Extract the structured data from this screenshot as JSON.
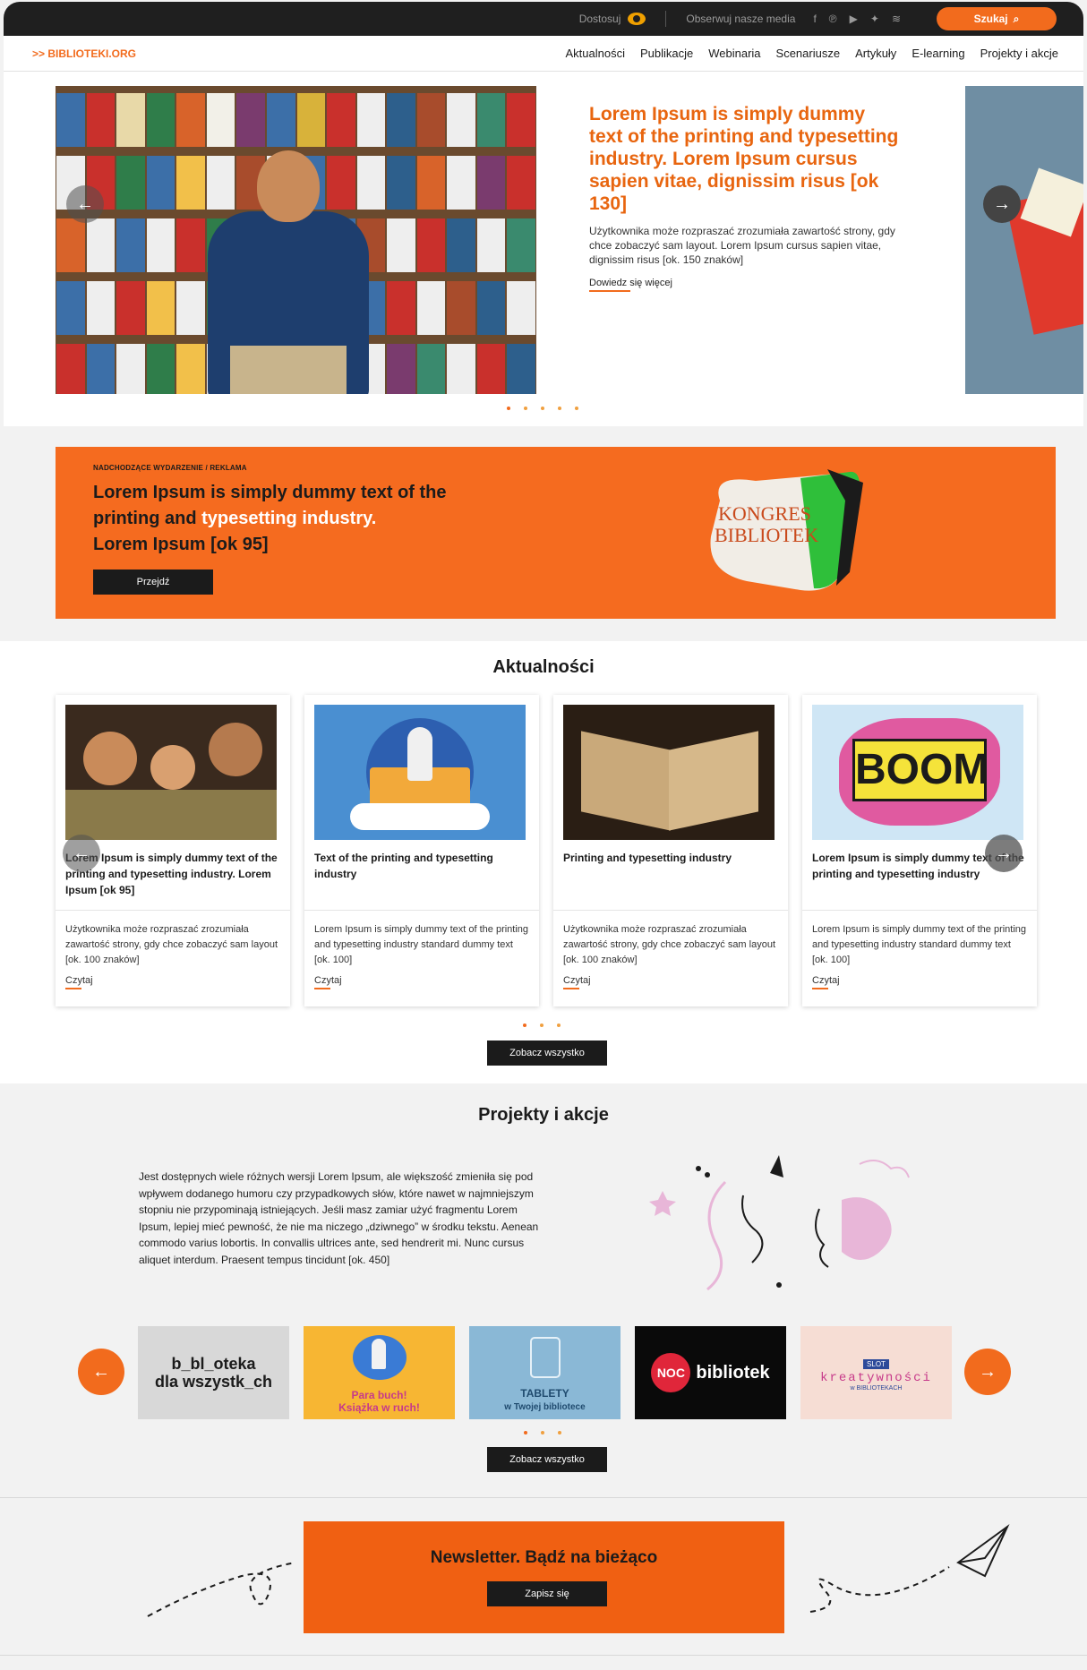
{
  "topbar": {
    "customize_label": "Dostosuj",
    "follow_label": "Obserwuj nasze media",
    "social_icons": [
      "facebook-icon",
      "pinterest-icon",
      "youtube-icon",
      "twitter-icon",
      "rss-icon"
    ],
    "search_label": "Szukaj"
  },
  "nav": {
    "logo": ">> BIBLIOTEKI.ORG",
    "items": [
      "Aktualności",
      "Publikacje",
      "Webinaria",
      "Scenariusze",
      "Artykuły",
      "E-learning",
      "Projekty i akcje"
    ]
  },
  "hero": {
    "title": "Lorem Ipsum is simply dummy text of the printing and typesetting industry. Lorem Ipsum cursus sapien vitae, dignissim risus [ok 130]",
    "description": "Użytkownika może rozpraszać zrozumiała zawartość strony, gdy chce zobaczyć sam layout. Lorem Ipsum cursus sapien vitae, dignissim risus [ok. 150 znaków]",
    "link": "Dowiedz się więcej",
    "slide_count": 5,
    "active_slide": 1
  },
  "banner": {
    "kicker": "NADCHODZĄCE WYDARZENIE / REKLAMA",
    "title_part1": "Lorem Ipsum is simply dummy text of the printing and ",
    "title_highlight": "typesetting industry.",
    "title_part2": "Lorem Ipsum [ok 95]",
    "button": "Przejdź",
    "logo_line1": "KONGRES",
    "logo_line2": "BIBLIOTEK"
  },
  "news": {
    "title": "Aktualności",
    "cards": [
      {
        "title": "Lorem Ipsum is simply dummy text of the printing and typesetting industry. Lorem Ipsum [ok 95]",
        "desc": "Użytkownika może rozpraszać zrozumiała zawartość strony, gdy chce zobaczyć sam layout [ok. 100 znaków]",
        "link": "Czytaj"
      },
      {
        "title": "Text of the printing and typesetting industry",
        "desc": "Lorem Ipsum is simply dummy text of the printing and typesetting industry standard dummy text [ok. 100]",
        "link": "Czytaj"
      },
      {
        "title": "Printing and typesetting industry",
        "desc": "Użytkownika może rozpraszać zrozumiała zawartość strony, gdy chce zobaczyć sam layout [ok. 100 znaków]",
        "link": "Czytaj"
      },
      {
        "title": "Lorem Ipsum is simply dummy text of the printing and typesetting industry",
        "desc": "Lorem Ipsum is simply dummy text of the printing and typesetting industry standard dummy text [ok. 100]",
        "link": "Czytaj"
      }
    ],
    "see_all": "Zobacz wszystko"
  },
  "projects": {
    "title": "Projekty i akcje",
    "text": "Jest dostępnych wiele różnych wersji Lorem Ipsum, ale większość zmieniła się pod wpływem dodanego humoru czy przypadkowych słów, które nawet w najmniejszym stopniu nie przypominają istniejących. Jeśli masz zamiar użyć fragmentu Lorem Ipsum, lepiej mieć pewność, że nie ma niczego „dziwnego” w środku tekstu. Aenean commodo varius lobortis. In convallis ultrices ante, sed hendrerit mi. Nunc cursus aliquet interdum. Praesent tempus tincidunt [ok. 450]",
    "tiles": {
      "t1_line1": "b_bl_oteka",
      "t1_line2": "dla wszystk_ch",
      "t2_line1": "Para buch!",
      "t2_line2": "Książka w ruch!",
      "t3_line1": "TABLETY",
      "t3_line2": "w Twojej bibliotece",
      "t4_text": "bibliotek",
      "t4_badge": "NOC",
      "t5_top": "SLOT",
      "t5_main": "kreatywności",
      "t5_sub": "w BIBLIOTEKACH"
    },
    "see_all": "Zobacz wszystko"
  },
  "newsletter": {
    "title": "Newsletter. Bądź na bieżąco",
    "button": "Zapisz się"
  }
}
